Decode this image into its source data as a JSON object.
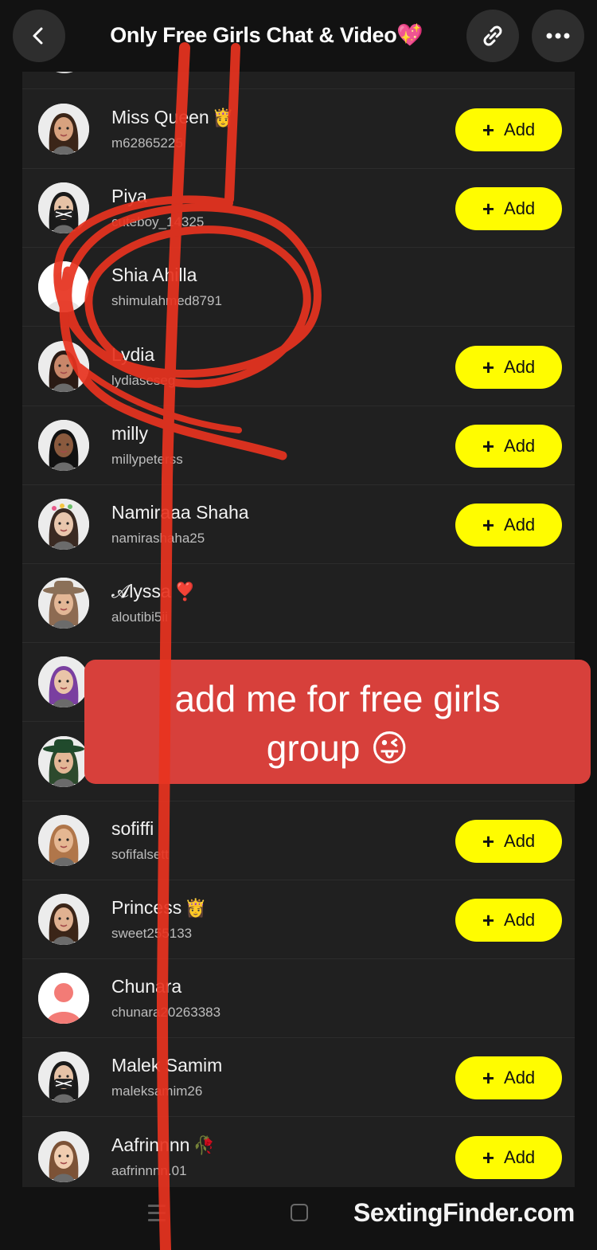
{
  "header": {
    "title": "Only Free Girls Chat & Video💖",
    "back_icon": "chevron-left-icon",
    "link_icon": "link-icon",
    "more_icon": "more-horizontal-icon"
  },
  "members": [
    {
      "name": "Miss Queen",
      "emoji": "👸",
      "username": "m62865225",
      "add": true,
      "avatar": "bitmoji-brown-hair"
    },
    {
      "name": "Piya",
      "emoji": "",
      "username": "cuteboy_14325",
      "add": true,
      "avatar": "bitmoji-masked"
    },
    {
      "name": "Shia Ahilla",
      "emoji": "",
      "username": "shimulahmed8791",
      "add": false,
      "avatar": "default-silhouette-white"
    },
    {
      "name": "Lydia",
      "emoji": "",
      "username": "lydiaseseg",
      "add": true,
      "avatar": "bitmoji-dark-hair"
    },
    {
      "name": "milly",
      "emoji": "",
      "username": "millypeterss",
      "add": true,
      "avatar": "bitmoji-cap"
    },
    {
      "name": "Namiraaa Shaha",
      "emoji": "",
      "username": "namirashaha25",
      "add": true,
      "avatar": "bitmoji-flowers"
    },
    {
      "name": "𝓐lyssa",
      "emoji": "❣️",
      "username": "aloutibi5ii",
      "add": false,
      "avatar": "bitmoji-cowboy"
    },
    {
      "name": "",
      "emoji": "",
      "username": "",
      "add": false,
      "avatar": "bitmoji-purple-hair"
    },
    {
      "name": "",
      "emoji": "",
      "username": "",
      "add": false,
      "avatar": "bitmoji-green-hat"
    },
    {
      "name": "sofiffi",
      "emoji": "",
      "username": "sofifalsett",
      "add": true,
      "avatar": "bitmoji-dog-filter"
    },
    {
      "name": "Princess",
      "emoji": "👸",
      "username": "sweet255133",
      "add": true,
      "avatar": "bitmoji-long-hair"
    },
    {
      "name": "Chunara",
      "emoji": "",
      "username": "chunara20263383",
      "add": false,
      "avatar": "default-silhouette-red"
    },
    {
      "name": "Malek Samim",
      "emoji": "",
      "username": "maleksamim26",
      "add": true,
      "avatar": "bitmoji-masked-ears"
    },
    {
      "name": "Aafrinnnn",
      "emoji": "🥀",
      "username": "aafrinnnn.01",
      "add": true,
      "avatar": "bitmoji-light-hair"
    }
  ],
  "add_label": "Add",
  "banner": {
    "line1": "add me for free girls",
    "line2": "group 😜"
  },
  "watermark": "SextingFinder.com",
  "colors": {
    "accent_yellow": "#fffc00",
    "banner_red": "#d7403b",
    "scribble_red": "#e8331f",
    "background": "#121212",
    "list_bg": "#202020"
  }
}
